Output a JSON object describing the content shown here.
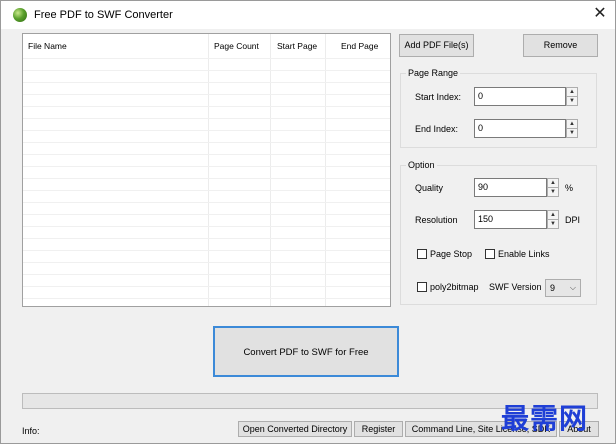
{
  "window": {
    "title": "Free PDF to SWF Converter",
    "close_glyph": "✕"
  },
  "file_list": {
    "columns": [
      "File Name",
      "Page Count",
      "Start Page",
      "End Page"
    ],
    "rows": []
  },
  "buttons": {
    "add": "Add PDF File(s)",
    "remove": "Remove",
    "convert": "Convert PDF to SWF for Free",
    "open_dir": "Open Converted Directory",
    "register": "Register",
    "cmdline": "Command Line, Site License, SDK",
    "about": "About"
  },
  "page_range": {
    "title": "Page Range",
    "start_label": "Start Index:",
    "start_value": "0",
    "end_label": "End Index:",
    "end_value": "0"
  },
  "option": {
    "title": "Option",
    "quality_label": "Quality",
    "quality_value": "90",
    "quality_unit": "%",
    "resolution_label": "Resolution",
    "resolution_value": "150",
    "resolution_unit": "DPI",
    "page_stop_label": "Page Stop",
    "page_stop_checked": false,
    "enable_links_label": "Enable Links",
    "enable_links_checked": false,
    "poly2bitmap_label": "poly2bitmap",
    "poly2bitmap_checked": false,
    "swf_version_label": "SWF Version",
    "swf_version_value": "9"
  },
  "progress": {
    "fraction": 0
  },
  "status": {
    "info_label": "Info:"
  },
  "watermark": {
    "text": "最需网"
  },
  "colors": {
    "convert_border": "#3c8ad8",
    "watermark": "#1f3fd6"
  }
}
